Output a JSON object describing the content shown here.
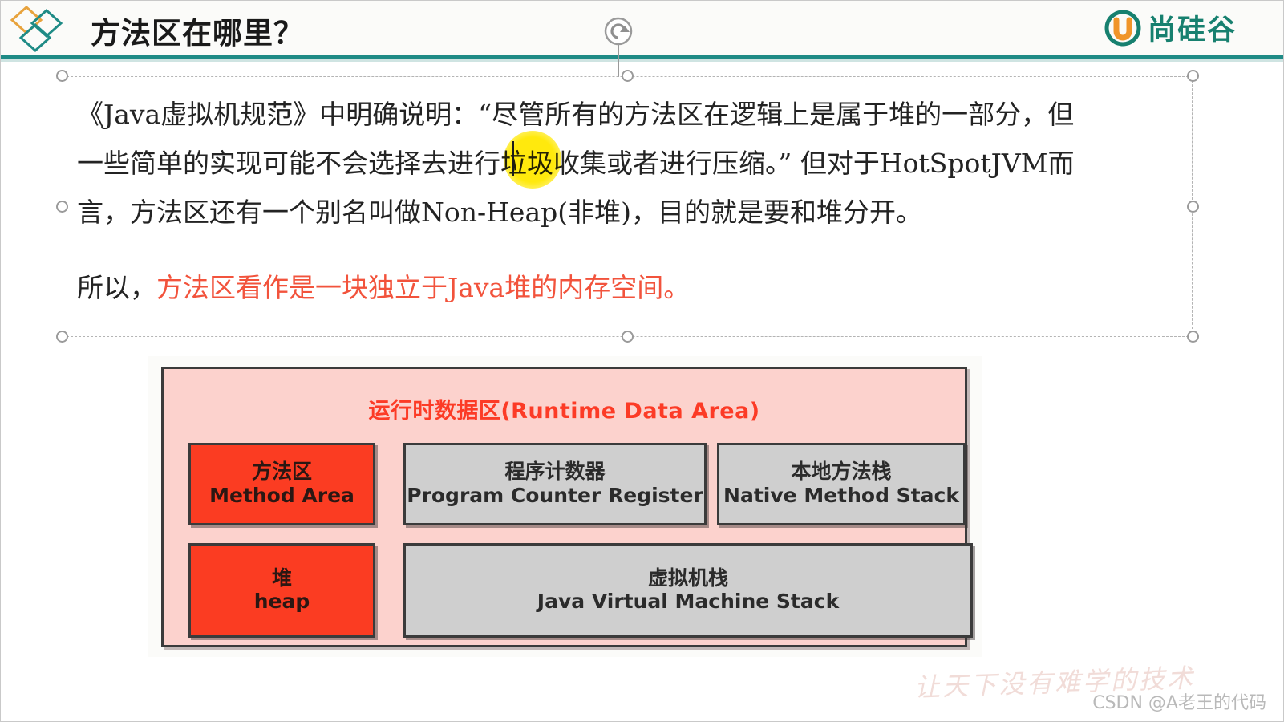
{
  "header": {
    "title": "方法区在哪里？",
    "brand_text": "尚硅谷",
    "brand_icon": "circle-u-logo-icon",
    "diamond_logo": "diamond-logo-icon",
    "rule_color": "#1f8b86",
    "brand_color": "#17806f"
  },
  "toolbar": {
    "rotate_handle": "rotate-handle-icon"
  },
  "body": {
    "paragraph1_lines": [
      "《Java虚拟机规范》中明确说明：“尽管所有的方法区在逻辑上是属于堆的一部分，但",
      "一些简单的实现可能不会选择去进行垃圾收集或者进行压缩。”  但对于HotSpotJVM而",
      "言，方法区还有一个别名叫做Non-Heap(非堆)，目的就是要和堆分开。"
    ],
    "paragraph2": {
      "prefix": "所以，",
      "highlight": "方法区看作是一块独立于Java堆的内存空间。",
      "highlight_color": "#f2533c"
    }
  },
  "diagram": {
    "container_title": "运行时数据区(Runtime Data Area)",
    "container_bg": "#fcd2cd",
    "container_title_color": "#fc3b26",
    "cells": [
      {
        "id": "method-area",
        "cn": "方法区",
        "en": "Method Area",
        "color": "#fb3c22",
        "style": "red"
      },
      {
        "id": "program-counter",
        "cn": "程序计数器",
        "en": "Program Counter Register",
        "color": "#cfcfcf",
        "style": "grey"
      },
      {
        "id": "native-method-stack",
        "cn": "本地方法栈",
        "en": "Native Method Stack",
        "color": "#cfcfcf",
        "style": "grey"
      },
      {
        "id": "heap",
        "cn": "堆",
        "en": "heap",
        "color": "#fb3c22",
        "style": "red"
      },
      {
        "id": "jvm-stack",
        "cn": "虚拟机栈",
        "en": "Java Virtual Machine Stack",
        "color": "#cfcfcf",
        "style": "grey"
      }
    ]
  },
  "watermark": {
    "script": "让天下没有难学的技术",
    "csdn": "CSDN @A老王的代码"
  }
}
